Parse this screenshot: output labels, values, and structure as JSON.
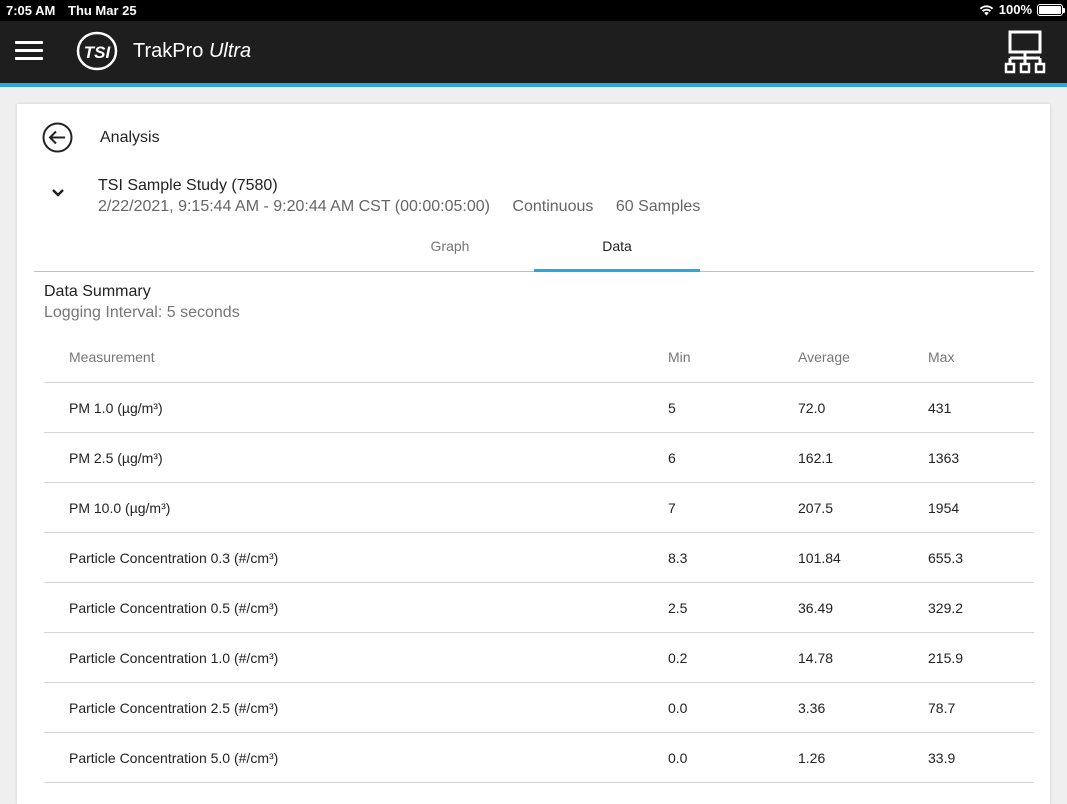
{
  "status_bar": {
    "time": "7:05 AM",
    "date": "Thu Mar 25",
    "battery": "100%"
  },
  "app_bar": {
    "brand": "TrakPro",
    "brand_suffix": "Ultra",
    "logo_text": "TSI",
    "accent": "#2aa7df"
  },
  "page": {
    "title": "Analysis"
  },
  "study": {
    "name": "TSI Sample Study (7580)",
    "time_range": "2/22/2021, 9:15:44 AM - 9:20:44 AM CST (00:00:05:00)",
    "mode": "Continuous",
    "samples": "60 Samples"
  },
  "tabs": [
    {
      "label": "Graph"
    },
    {
      "label": "Data"
    }
  ],
  "summary": {
    "title": "Data Summary",
    "interval": "Logging Interval: 5 seconds"
  },
  "table": {
    "headers": [
      "Measurement",
      "Min",
      "Average",
      "Max"
    ],
    "rows": [
      [
        "PM 1.0 (µg/m³)",
        "5",
        "72.0",
        "431"
      ],
      [
        "PM 2.5 (µg/m³)",
        "6",
        "162.1",
        "1363"
      ],
      [
        "PM 10.0 (µg/m³)",
        "7",
        "207.5",
        "1954"
      ],
      [
        "Particle Concentration 0.3 (#/cm³)",
        "8.3",
        "101.84",
        "655.3"
      ],
      [
        "Particle Concentration 0.5 (#/cm³)",
        "2.5",
        "36.49",
        "329.2"
      ],
      [
        "Particle Concentration 1.0 (#/cm³)",
        "0.2",
        "14.78",
        "215.9"
      ],
      [
        "Particle Concentration 2.5 (#/cm³)",
        "0.0",
        "3.36",
        "78.7"
      ],
      [
        "Particle Concentration 5.0 (#/cm³)",
        "0.0",
        "1.26",
        "33.9"
      ]
    ]
  },
  "icons": {
    "menu": "hamburger-menu-icon",
    "logo": "tsi-logo-icon",
    "network": "network-topology-icon",
    "back": "arrow-left-circle-icon",
    "expand": "chevron-down-icon",
    "wifi": "wifi-icon",
    "battery": "battery-icon"
  }
}
